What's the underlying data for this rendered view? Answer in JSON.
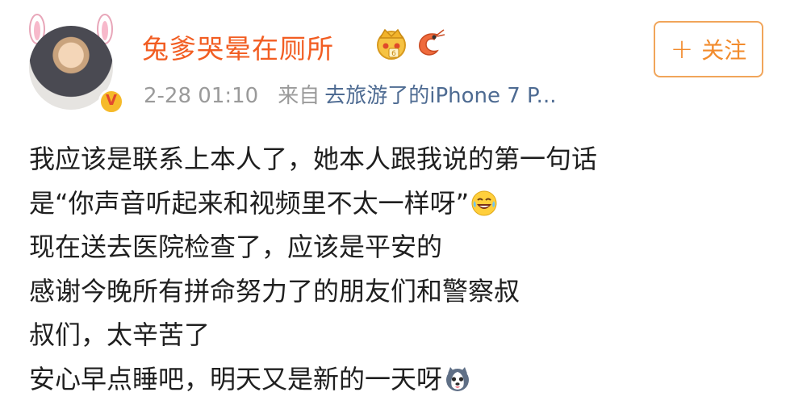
{
  "post": {
    "username": "兔爹哭晕在厕所",
    "verified_badge": "V",
    "timestamp": "2-28 01:10",
    "from_label": "来自",
    "source": "去旅游了的iPhone 7 P..."
  },
  "follow_button": {
    "icon": "plus-icon",
    "label": "关注"
  },
  "content": {
    "lines": [
      "我应该是联系上本人了，她本人跟我说的第一句话",
      "是“你声音听起来和视频里不太一样呀”",
      "现在送去医院检查了，应该是平安的",
      "感谢今晚所有拼命努力了的朋友们和警察叔",
      "叔们，太辛苦了",
      "安心早点睡吧，明天又是新的一天呀"
    ]
  },
  "icons": {
    "crown_badge": "crown-vip-icon",
    "shrimp_badge": "shrimp-fan-badge-icon",
    "laugh_cry_emoji": "laugh-cry-emoji-icon",
    "husky_emoji": "husky-emoji-icon"
  },
  "colors": {
    "username": "#f25d22",
    "source_link": "#4e6b92",
    "meta_text": "#9a9a9a",
    "follow_border": "#f1a55a",
    "follow_text": "#f28b2c"
  }
}
